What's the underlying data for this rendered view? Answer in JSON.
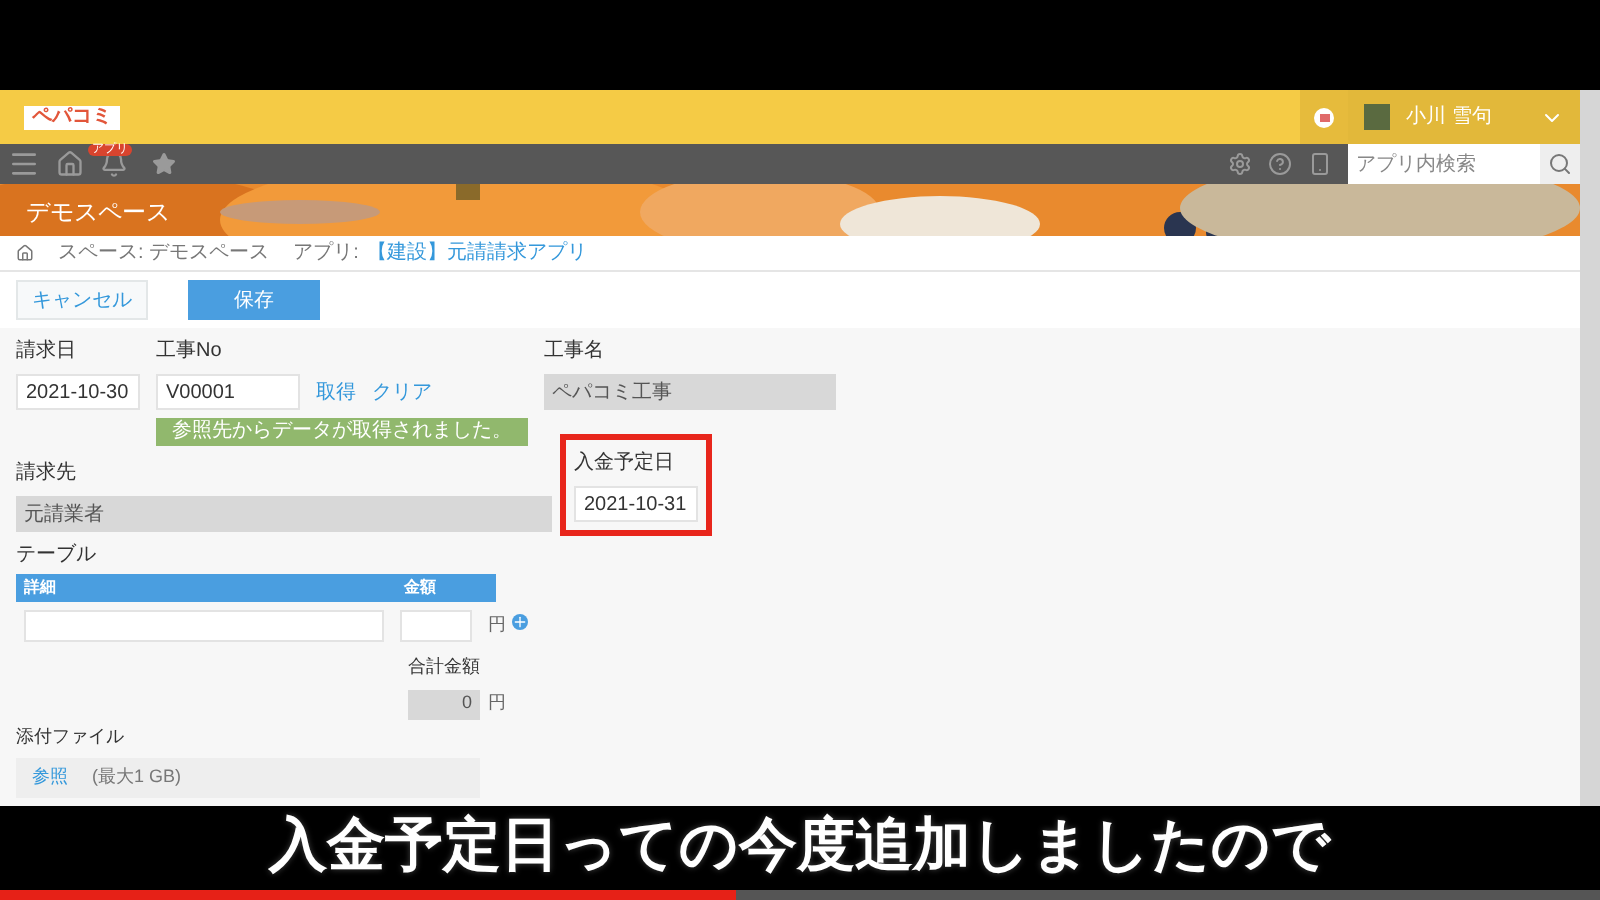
{
  "header": {
    "logo": "ペパコミ",
    "user_name": "小川 雪句"
  },
  "nav": {
    "badge": "アプリ",
    "search": {
      "placeholder": "アプリ内検索"
    }
  },
  "banner": {
    "title": "デモスペース"
  },
  "breadcrumb": [
    "スペース: デモスペース",
    "アプリ:"
  ],
  "breadcrumb_link": "【建設】元請請求アプリ",
  "buttons": [
    {
      "label": "キャンセル",
      "kind": "secondary"
    },
    {
      "label": "保存",
      "kind": "primary"
    }
  ],
  "fields_row1": [
    {
      "label": "請求日",
      "value": "2021-10-30",
      "kind": "date"
    },
    {
      "label": "工事No",
      "value": "V00001",
      "kind": "lookup",
      "links": [
        "取得",
        "クリア"
      ],
      "message": "参照先からデータが取得されました。"
    },
    {
      "label": "工事名",
      "value": "ペパコミ工事",
      "kind": "readonly"
    }
  ],
  "fields_row2": [
    {
      "label": "請求先",
      "value": "元請業者",
      "kind": "readonly",
      "highlighted": false
    },
    {
      "label": "入金予定日",
      "value": "2021-10-31",
      "kind": "date",
      "highlighted": true
    }
  ],
  "table": {
    "label": "テーブル",
    "columns": [
      "詳細",
      "金額"
    ],
    "unit": "円"
  },
  "total": {
    "label": "合計金額",
    "value": "0",
    "unit": "円"
  },
  "attachment": {
    "label": "添付ファイル",
    "link": "参照",
    "note": "(最大1 GB)"
  },
  "video": {
    "subtitle": "入金予定日っての今度追加しましたので",
    "progress": {
      "level": 0.46
    }
  }
}
